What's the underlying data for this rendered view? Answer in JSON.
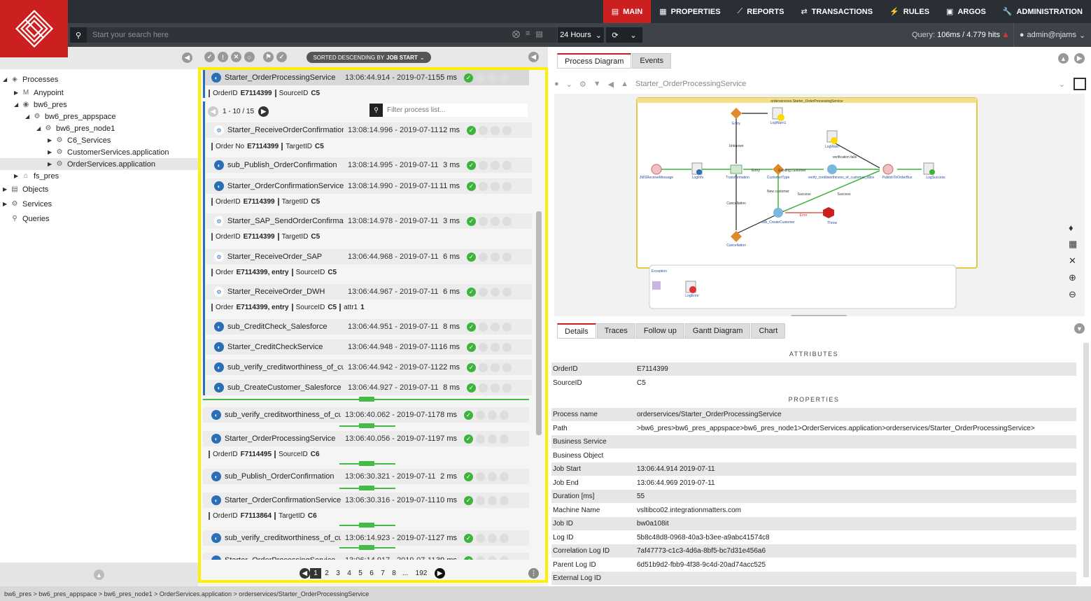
{
  "nav": {
    "items": [
      {
        "label": "MAIN",
        "icon": "dashboard-icon"
      },
      {
        "label": "PROPERTIES",
        "icon": "grid-icon"
      },
      {
        "label": "REPORTS",
        "icon": "chart-icon"
      },
      {
        "label": "TRANSACTIONS",
        "icon": "arrows-icon"
      },
      {
        "label": "RULES",
        "icon": "bolt-icon"
      },
      {
        "label": "ARGOS",
        "icon": "square-icon"
      },
      {
        "label": "ADMINISTRATION",
        "icon": "wrench-icon"
      }
    ]
  },
  "search": {
    "placeholder": "Start your search here",
    "range": "24 Hours",
    "query_label": "Query:",
    "query_value": "106ms / 4.779 hits",
    "user": "admin@njams"
  },
  "tree": {
    "items": [
      {
        "label": "Processes",
        "depth": 0
      },
      {
        "label": "Anypoint",
        "depth": 1
      },
      {
        "label": "bw6_pres",
        "depth": 1
      },
      {
        "label": "bw6_pres_appspace",
        "depth": 2
      },
      {
        "label": "bw6_pres_node1",
        "depth": 3
      },
      {
        "label": "C6_Services",
        "depth": 4
      },
      {
        "label": "CustomerServices.application",
        "depth": 4
      },
      {
        "label": "OrderServices.application",
        "depth": 4
      },
      {
        "label": "fs_pres",
        "depth": 1
      },
      {
        "label": "Objects",
        "depth": 0
      },
      {
        "label": "Services",
        "depth": 0
      },
      {
        "label": "Queries",
        "depth": 0
      }
    ]
  },
  "list": {
    "sorted_label": "SORTED DESCENDING BY",
    "sorted_field": "JOB START",
    "pager": "1 - 10 / 15",
    "filter_placeholder": "Filter process list...",
    "rows": [
      {
        "name": "Starter_OrderProcessingService",
        "time": "13:06:44.914 - 2019-07-11",
        "dur": "55 ms"
      },
      {
        "name": "Starter_ReceiveOrderConfirmation_C",
        "time": "13:08:14.996 - 2019-07-11",
        "dur": "12 ms"
      },
      {
        "name": "sub_Publish_OrderConfirmation",
        "time": "13:08:14.995 - 2019-07-11",
        "dur": "3 ms"
      },
      {
        "name": "Starter_OrderConfirmationService",
        "time": "13:08:14.990 - 2019-07-11",
        "dur": "11 ms"
      },
      {
        "name": "Starter_SAP_SendOrderConfirmation",
        "time": "13:08:14.978 - 2019-07-11",
        "dur": "3 ms"
      },
      {
        "name": "Starter_ReceiveOrder_SAP",
        "time": "13:06:44.968 - 2019-07-11",
        "dur": "6 ms"
      },
      {
        "name": "Starter_ReceiveOrder_DWH",
        "time": "13:06:44.967 - 2019-07-11",
        "dur": "6 ms"
      },
      {
        "name": "sub_CreditCheck_Salesforce",
        "time": "13:06:44.951 - 2019-07-11",
        "dur": "8 ms"
      },
      {
        "name": "Starter_CreditCheckService",
        "time": "13:06:44.948 - 2019-07-11",
        "dur": "16 ms"
      },
      {
        "name": "sub_verify_creditworthiness_of_custo",
        "time": "13:06:44.942 - 2019-07-11",
        "dur": "22 ms"
      },
      {
        "name": "sub_CreateCustomer_Salesforce",
        "time": "13:06:44.927 - 2019-07-11",
        "dur": "8 ms"
      },
      {
        "name": "sub_verify_creditworthiness_of_custo",
        "time": "13:06:40.062 - 2019-07-11",
        "dur": "78 ms"
      },
      {
        "name": "Starter_OrderProcessingService",
        "time": "13:06:40.056 - 2019-07-11",
        "dur": "97 ms"
      },
      {
        "name": "sub_Publish_OrderConfirmation",
        "time": "13:06:30.321 - 2019-07-11",
        "dur": "2 ms"
      },
      {
        "name": "Starter_OrderConfirmationService",
        "time": "13:06:30.316 - 2019-07-11",
        "dur": "10 ms"
      },
      {
        "name": "sub_verify_creditworthiness_of_custo",
        "time": "13:06:14.923 - 2019-07-11",
        "dur": "27 ms"
      },
      {
        "name": "Starter_OrderProcessingService",
        "time": "13:06:14.917 - 2019-07-11",
        "dur": "39 ms"
      }
    ],
    "attrs": [
      [
        "OrderID",
        "E7114399",
        "SourceID",
        "C5"
      ],
      [
        "Order No",
        "E7114399",
        "TargetID",
        "C5"
      ],
      [
        "OrderID",
        "E7114399",
        "TargetID",
        "C5"
      ],
      [
        "OrderID",
        "E7114399",
        "TargetID",
        "C5"
      ],
      [
        "Order",
        "E7114399, entry",
        "SourceID",
        "C5"
      ],
      [
        "Order",
        "E7114399, entry",
        "SourceID",
        "C5",
        "attr1",
        "1"
      ],
      [
        "OrderID",
        "F7114495",
        "SourceID",
        "C6"
      ],
      [
        "OrderID",
        "F7113864",
        "TargetID",
        "C6"
      ]
    ],
    "pages": [
      "1",
      "2",
      "3",
      "4",
      "5",
      "6",
      "7",
      "8",
      "...",
      "192"
    ]
  },
  "diagram": {
    "tabs": [
      "Process Diagram",
      "Events"
    ],
    "process": "Starter_OrderProcessingService",
    "title": "orderservices.Starter_OrderProcessingService",
    "labels": [
      "Entry",
      "LogWarn1",
      "Unknown",
      "LogWarn",
      "verification fails",
      "JMSReceiveMessage",
      "LogInfo",
      "Transformation",
      "Entry",
      "CustomerType",
      "Existing customer",
      "verify_creditworthiness_of_customer_alice",
      "Success",
      "PublishToOrderBus",
      "LogSuccess",
      "New customer",
      "Success",
      "Cancellation",
      "sub_CreateCustomer",
      "Error",
      "Throw",
      "Cancellation",
      "Exception",
      "LogError"
    ]
  },
  "details": {
    "tabs": [
      "Details",
      "Traces",
      "Follow up",
      "Gantt Diagram",
      "Chart"
    ],
    "attributes_title": "ATTRIBUTES",
    "properties_title": "PROPERTIES",
    "attributes": [
      [
        "OrderID",
        "E7114399"
      ],
      [
        "SourceID",
        "C5"
      ]
    ],
    "properties": [
      [
        "Process name",
        "orderservices/Starter_OrderProcessingService"
      ],
      [
        "Path",
        ">bw6_pres>bw6_pres_appspace>bw6_pres_node1>OrderServices.application>orderservices/Starter_OrderProcessingService>"
      ],
      [
        "Business Service",
        ""
      ],
      [
        "Business Object",
        ""
      ],
      [
        "Job Start",
        "13:06:44.914  2019-07-11"
      ],
      [
        "Job End",
        "13:06:44.969  2019-07-11"
      ],
      [
        "Duration [ms]",
        "55"
      ],
      [
        "Machine Name",
        "vsltibco02.integrationmatters.com"
      ],
      [
        "Job ID",
        "bw0a108it"
      ],
      [
        "Log ID",
        "5b8c48d8-0968-40a3-b3ee-a9abc41574c8"
      ],
      [
        "Correlation Log ID",
        "7af47773-c1c3-4d6a-8bf5-bc7d31e456a6"
      ],
      [
        "Parent Log ID",
        "6d51b9d2-fbb9-4f38-9c4d-20ad74acc525"
      ],
      [
        "External Log ID",
        ""
      ]
    ]
  },
  "status": "bw6_pres > bw6_pres_appspace > bw6_pres_node1 > OrderServices.application > orderservices/Starter_OrderProcessingService"
}
